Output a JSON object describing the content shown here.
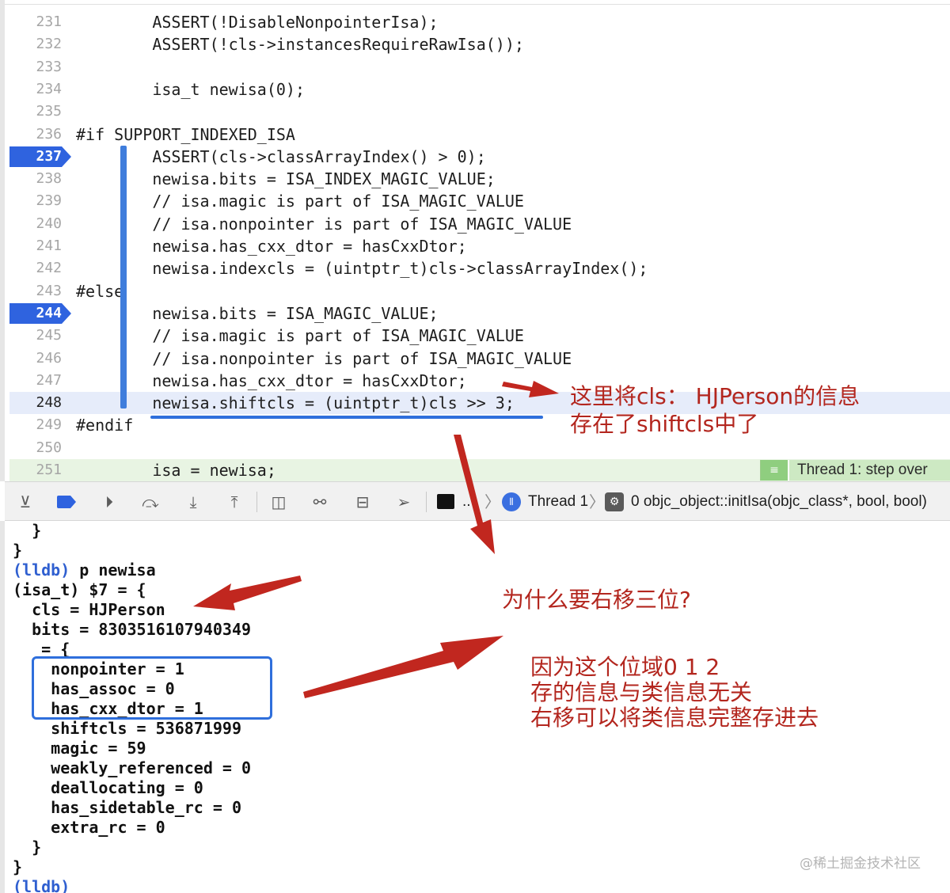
{
  "editor": {
    "lines": [
      {
        "num": "231",
        "code": "        ASSERT(!DisableNonpointerIsa);"
      },
      {
        "num": "232",
        "code": "        ASSERT(!cls->instancesRequireRawIsa());"
      },
      {
        "num": "233",
        "code": ""
      },
      {
        "num": "234",
        "code": "        isa_t newisa(0);"
      },
      {
        "num": "235",
        "code": ""
      },
      {
        "num": "236",
        "code": "#if SUPPORT_INDEXED_ISA"
      },
      {
        "num": "237",
        "code": "        ASSERT(cls->classArrayIndex() > 0);"
      },
      {
        "num": "238",
        "code": "        newisa.bits = ISA_INDEX_MAGIC_VALUE;"
      },
      {
        "num": "239",
        "code": "        // isa.magic is part of ISA_MAGIC_VALUE"
      },
      {
        "num": "240",
        "code": "        // isa.nonpointer is part of ISA_MAGIC_VALUE"
      },
      {
        "num": "241",
        "code": "        newisa.has_cxx_dtor = hasCxxDtor;"
      },
      {
        "num": "242",
        "code": "        newisa.indexcls = (uintptr_t)cls->classArrayIndex();"
      },
      {
        "num": "243",
        "code": "#else"
      },
      {
        "num": "244",
        "code": "        newisa.bits = ISA_MAGIC_VALUE;"
      },
      {
        "num": "245",
        "code": "        // isa.magic is part of ISA_MAGIC_VALUE"
      },
      {
        "num": "246",
        "code": "        // isa.nonpointer is part of ISA_MAGIC_VALUE"
      },
      {
        "num": "247",
        "code": "        newisa.has_cxx_dtor = hasCxxDtor;"
      },
      {
        "num": "248",
        "code": "        newisa.shiftcls = (uintptr_t)cls >> 3;"
      },
      {
        "num": "249",
        "code": "#endif"
      },
      {
        "num": "250",
        "code": ""
      },
      {
        "num": "251",
        "code": "        isa = newisa;"
      }
    ],
    "thread_badge": "Thread 1: step over"
  },
  "debug_bar": {
    "thread_label": "Thread 1",
    "frame_label": "0 objc_object::initIsa(objc_class*, bool, bool)",
    "ellipsis": "..",
    "chevron": "〉"
  },
  "console": {
    "lines": [
      {
        "prompt": "",
        "text": "  }"
      },
      {
        "prompt": "",
        "text": "}"
      },
      {
        "prompt": "(lldb)",
        "text": " p newisa"
      },
      {
        "prompt": "",
        "text": "(isa_t) $7 = {"
      },
      {
        "prompt": "",
        "text": "  cls = HJPerson"
      },
      {
        "prompt": "",
        "text": "  bits = 8303516107940349"
      },
      {
        "prompt": "",
        "text": "   = {"
      },
      {
        "prompt": "",
        "text": "    nonpointer = 1"
      },
      {
        "prompt": "",
        "text": "    has_assoc = 0"
      },
      {
        "prompt": "",
        "text": "    has_cxx_dtor = 1"
      },
      {
        "prompt": "",
        "text": "    shiftcls = 536871999"
      },
      {
        "prompt": "",
        "text": "    magic = 59"
      },
      {
        "prompt": "",
        "text": "    weakly_referenced = 0"
      },
      {
        "prompt": "",
        "text": "    deallocating = 0"
      },
      {
        "prompt": "",
        "text": "    has_sidetable_rc = 0"
      },
      {
        "prompt": "",
        "text": "    extra_rc = 0"
      },
      {
        "prompt": "",
        "text": "  }"
      },
      {
        "prompt": "",
        "text": "}"
      },
      {
        "prompt": "(lldb)",
        "text": ""
      }
    ]
  },
  "annotations": {
    "note1_line1": "这里将cls： HJPerson的信息",
    "note1_line2": "存在了shiftcls中了",
    "question": "为什么要右移三位?",
    "answer_line1": "因为这个位域0 1 2",
    "answer_line2": "存的信息与类信息无关",
    "answer_line3": "右移可以将类信息完整存进去"
  },
  "watermark": "@稀土掘金技术社区",
  "colors": {
    "breakpoint_blue": "#2f63df",
    "annotation_red": "#b3261e",
    "box_blue": "#2f6fdc",
    "current_line_bg": "#e6ecfa",
    "pc_line_bg": "#e8f4e3",
    "thread_badge_bg": "#cde9c3",
    "lldb_prompt": "#2f5fd0"
  },
  "icons": {
    "toolbar": [
      "hide-debug-area-icon",
      "breakpoints-toggle-icon",
      "continue-icon",
      "step-over-icon",
      "step-into-icon",
      "step-out-icon",
      "view-hierarchy-icon",
      "memory-graph-icon",
      "environment-overrides-icon",
      "location-icon",
      "terminal-icon"
    ],
    "grip_glyph": "≡",
    "frame_glyph": "⚙",
    "thread_glyph": "⦀"
  }
}
